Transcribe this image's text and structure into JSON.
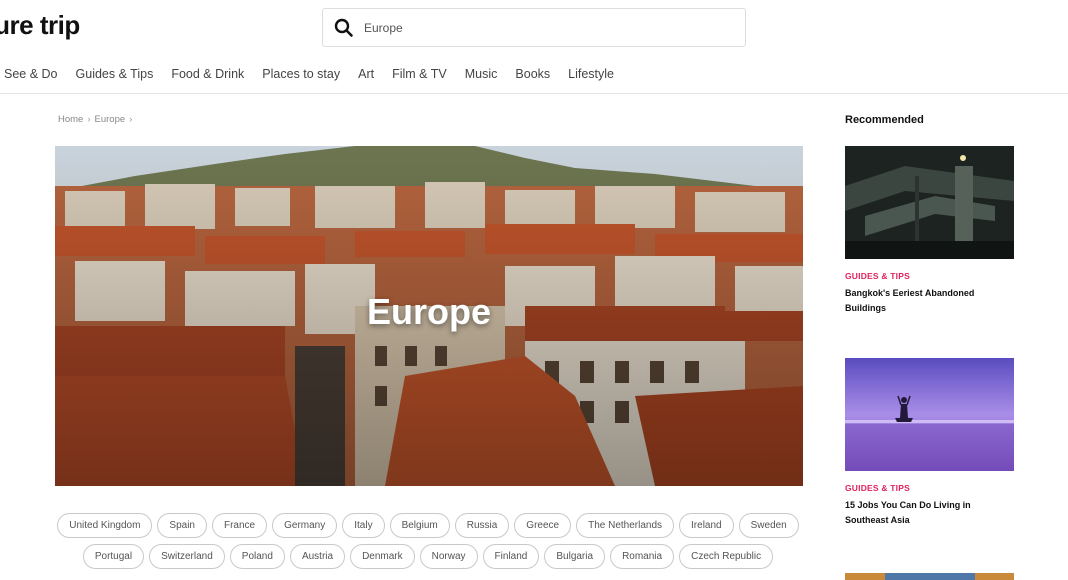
{
  "header": {
    "logo_text": "ture trip",
    "search": {
      "value": "Europe",
      "icon": "search-icon"
    }
  },
  "nav": {
    "items": [
      "See & Do",
      "Guides & Tips",
      "Food & Drink",
      "Places to stay",
      "Art",
      "Film & TV",
      "Music",
      "Books",
      "Lifestyle"
    ]
  },
  "breadcrumb": {
    "items": [
      "Home",
      "Europe"
    ],
    "separator": "›"
  },
  "hero": {
    "title": "Europe"
  },
  "tags": {
    "row1": [
      "United Kingdom",
      "Spain",
      "France",
      "Germany",
      "Italy",
      "Belgium",
      "Russia",
      "Greece",
      "The Netherlands",
      "Ireland",
      "Sweden"
    ],
    "row2": [
      "Portugal",
      "Switzerland",
      "Poland",
      "Austria",
      "Denmark",
      "Norway",
      "Finland",
      "Bulgaria",
      "Romania",
      "Czech Republic"
    ]
  },
  "recommended": {
    "heading": "Recommended",
    "cards": [
      {
        "category": "GUIDES & TIPS",
        "title": "Bangkok's Eeriest Abandoned Buildings"
      },
      {
        "category": "GUIDES & TIPS",
        "title": "15 Jobs You Can Do Living in Southeast Asia"
      }
    ]
  },
  "colors": {
    "accent": "#e0245e",
    "text": "#222222",
    "border": "#c9c9c9"
  }
}
